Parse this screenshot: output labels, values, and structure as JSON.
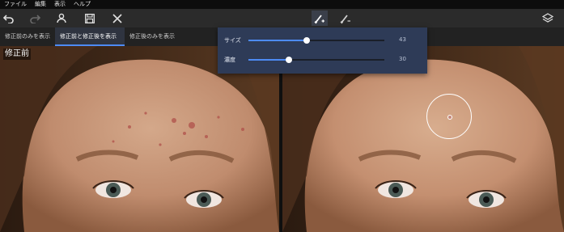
{
  "menu": [
    "ファイル",
    "編集",
    "表示",
    "ヘルプ"
  ],
  "toolbar": {
    "undo_icon": "undo-icon",
    "redo_icon": "redo-icon",
    "person_icon": "person-icon",
    "save_icon": "save-icon",
    "close_icon": "close-icon",
    "brush_add_icon": "brush-add-icon",
    "brush_remove_icon": "brush-remove-icon",
    "layers_icon": "layers-icon"
  },
  "view_tabs": [
    {
      "label": "修正前のみを表示",
      "active": false
    },
    {
      "label": "修正前と修正後を表示",
      "active": true
    },
    {
      "label": "修正後のみを表示",
      "active": false
    }
  ],
  "before_label": "修正前",
  "brush": {
    "size_label": "サイズ",
    "size_value": "43",
    "size_fraction": 0.43,
    "density_label": "濃度",
    "density_value": "30",
    "density_fraction": 0.3
  },
  "colors": {
    "accent": "#4d8bf5",
    "panel": "#2e3b57"
  }
}
